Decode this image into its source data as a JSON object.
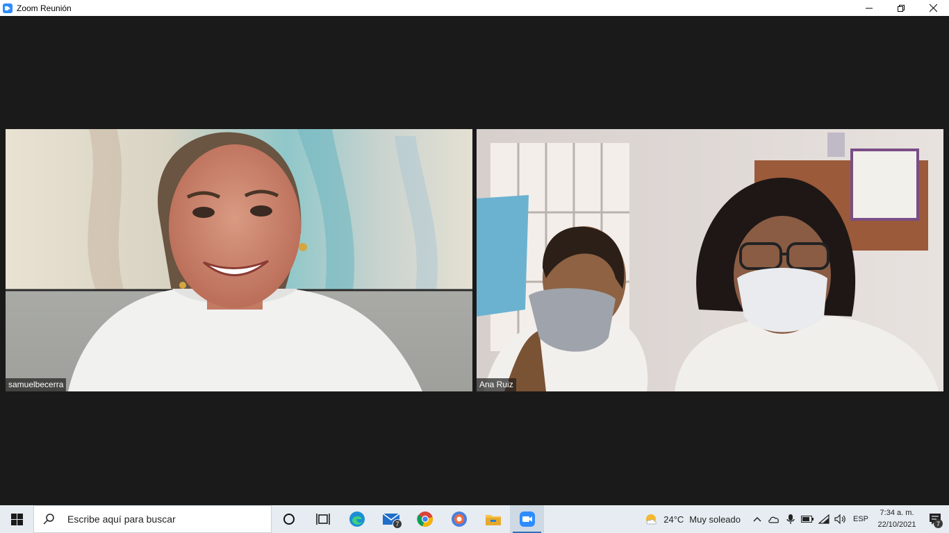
{
  "window": {
    "title": "Zoom Reunión",
    "controls": [
      "minimize-icon",
      "restore-icon",
      "close-icon"
    ]
  },
  "participants": [
    {
      "name": "samuelbecerra"
    },
    {
      "name": "Ana Ruiz"
    }
  ],
  "taskbar": {
    "search_placeholder": "Escribe aquí para buscar",
    "pinned": [
      {
        "icon": "cortana-icon"
      },
      {
        "icon": "task-view-icon"
      },
      {
        "icon": "edge-icon"
      },
      {
        "icon": "mail-icon",
        "badge": "7"
      },
      {
        "icon": "chrome-icon"
      },
      {
        "icon": "brave-icon"
      },
      {
        "icon": "file-explorer-icon"
      },
      {
        "icon": "zoom-icon",
        "active": true
      }
    ],
    "weather": {
      "temp": "24°C",
      "condition": "Muy soleado"
    },
    "language": "ESP",
    "time": "7:34 a. m.",
    "date": "22/10/2021",
    "notifications": "7"
  },
  "colors": {
    "stage_bg": "#1a1a1a",
    "zoom_blue": "#2d8cff",
    "taskbar_bg": "#e6ecf1"
  }
}
